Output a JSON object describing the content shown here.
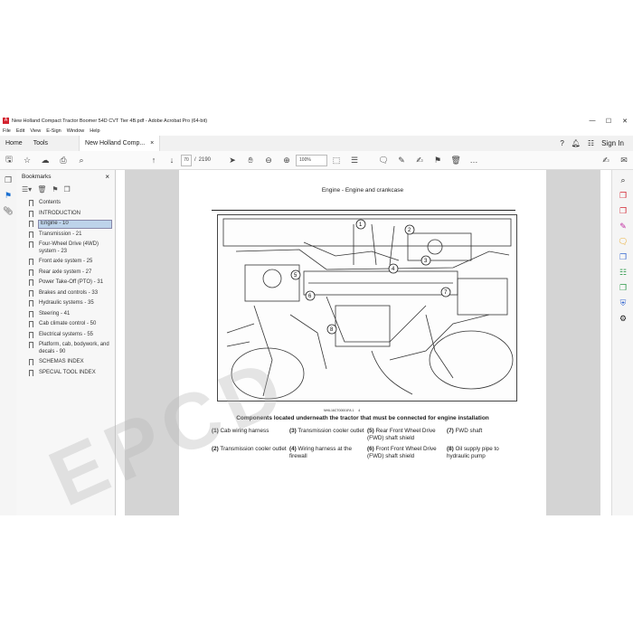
{
  "window": {
    "title": "New Holland Compact Tractor Boomer 54D CVT Tier 4B.pdf - Adobe Acrobat Pro (64-bit)",
    "controls": [
      "—",
      "☐",
      "✕"
    ]
  },
  "menu": [
    "File",
    "Edit",
    "View",
    "E-Sign",
    "Window",
    "Help"
  ],
  "tabs": {
    "home": "Home",
    "tools": "Tools",
    "doc": "New Holland Comp...",
    "doc_close": "×",
    "sign_in": "Sign In"
  },
  "toolbar": {
    "page_current": "70",
    "page_sep": "/",
    "page_total": "2190",
    "zoom": "100%"
  },
  "bookmarks": {
    "title": "Bookmarks",
    "close": "×",
    "items": [
      "Contents",
      "INTRODUCTION",
      "Engine - 10",
      "Transmission - 21",
      "Four-Wheel Drive (4WD) system - 23",
      "Front axle system - 25",
      "Rear axle system - 27",
      "Power Take-Off (PTO) - 31",
      "Brakes and controls - 33",
      "Hydraulic systems - 35",
      "Steering - 41",
      "Cab climate control - 50",
      "Electrical systems - 55",
      "Platform, cab, bodywork, and decals - 90",
      "SCHEMAS INDEX",
      "SPECIAL TOOL INDEX"
    ]
  },
  "page": {
    "header": "Engine - Engine and crankcase",
    "figure_ref": "NHIL16CT00001FA   1",
    "figure_ref_num": "4",
    "callouts": [
      "1",
      "2",
      "3",
      "4",
      "5",
      "6",
      "7",
      "8"
    ],
    "caption": "Components located underneath the tractor that must be connected for engine installation",
    "legend": [
      {
        "num": "(1)",
        "text": "Cab wiring harness"
      },
      {
        "num": "(3)",
        "text": "Transmission cooler outlet"
      },
      {
        "num": "(5)",
        "text": "Rear Front Wheel Drive (FWD) shaft shield"
      },
      {
        "num": "(7)",
        "text": "FWD shaft"
      },
      {
        "num": "(2)",
        "text": "Transmission cooler outlet"
      },
      {
        "num": "(4)",
        "text": "Wiring harness at the firewall"
      },
      {
        "num": "(6)",
        "text": "Front Front Wheel Drive (FWD) shaft shield"
      },
      {
        "num": "(8)",
        "text": "Oil supply pipe to hydraulic pump"
      }
    ]
  },
  "watermark": "EPCD",
  "colors": {
    "selected_bookmark": "#bdd3ea",
    "pdf_red": "#d3232f",
    "viewer_bg": "#d4d4d4"
  }
}
